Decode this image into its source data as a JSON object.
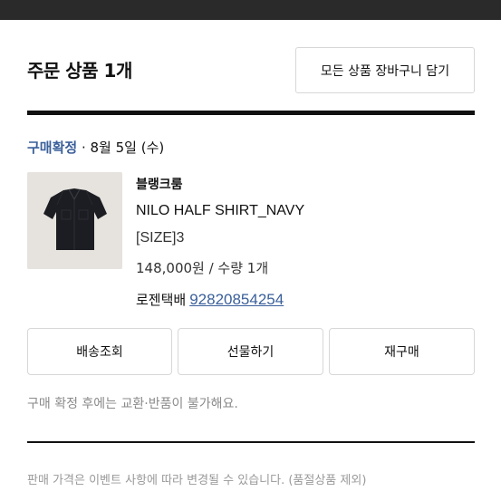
{
  "header": {
    "title": "주문 상품 1개",
    "add_all_to_cart": "모든 상품 장바구니 담기"
  },
  "order": {
    "status": "구매확정",
    "separator": " · ",
    "date": "8월 5일 (수)"
  },
  "product": {
    "image": "navy-half-shirt-photo",
    "brand": "블랭크룸",
    "name": "NILO HALF SHIRT_NAVY",
    "option": "[SIZE]3",
    "price_qty": "148,000원 / 수량 1개",
    "courier": "로젠택배",
    "tracking_number": "92820854254"
  },
  "actions": {
    "track_delivery": "배송조회",
    "gift": "선물하기",
    "reorder": "재구매"
  },
  "notice": "구매 확정 후에는 교환·반품이 불가해요.",
  "footer_note": "판매 가격은 이벤트 사항에 따라 변경될 수 있습니다. (품절상품 제외)",
  "colors": {
    "accent_blue": "#3a5f9a",
    "top_bar": "#2a2a2a",
    "rule": "#111111"
  }
}
